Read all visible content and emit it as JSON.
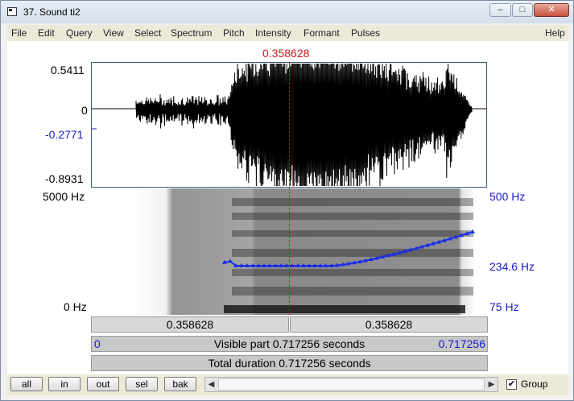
{
  "window": {
    "title": "37. Sound ti2",
    "minimize_glyph": "‒",
    "maximize_glyph": "□",
    "close_glyph": "✕"
  },
  "menu": [
    "File",
    "Edit",
    "Query",
    "View",
    "Select",
    "Spectrum",
    "Pitch",
    "Intensity",
    "Formant",
    "Pulses",
    "Help"
  ],
  "cursor": {
    "time": "0.358628"
  },
  "waveform": {
    "y_max": "0.5411",
    "y_zero": "0",
    "y_cursor_value": "-0.2771",
    "y_min": "-0.8931"
  },
  "spectrogram": {
    "freq_top": "5000 Hz",
    "freq_bottom": "0 Hz",
    "pitch_top": "500 Hz",
    "pitch_value": "234.6 Hz",
    "pitch_bottom": "75 Hz"
  },
  "time_bars": {
    "left_segment": "0.358628",
    "right_segment": "0.358628",
    "visible_start": "0",
    "visible_part": "Visible part 0.717256 seconds",
    "visible_end": "0.717256",
    "total_duration": "Total duration 0.717256 seconds"
  },
  "buttons": {
    "all": "all",
    "in": "in",
    "out": "out",
    "sel": "sel",
    "bak": "bak"
  },
  "scroll": {
    "left_arrow": "◀",
    "right_arrow": "▶"
  },
  "group": {
    "label": "Group",
    "checked": true,
    "check_glyph": "✔"
  },
  "colors": {
    "pitch": "#1a2ee6",
    "cursor": "#cc1a1a",
    "axis_blue": "#1a1acc"
  }
}
